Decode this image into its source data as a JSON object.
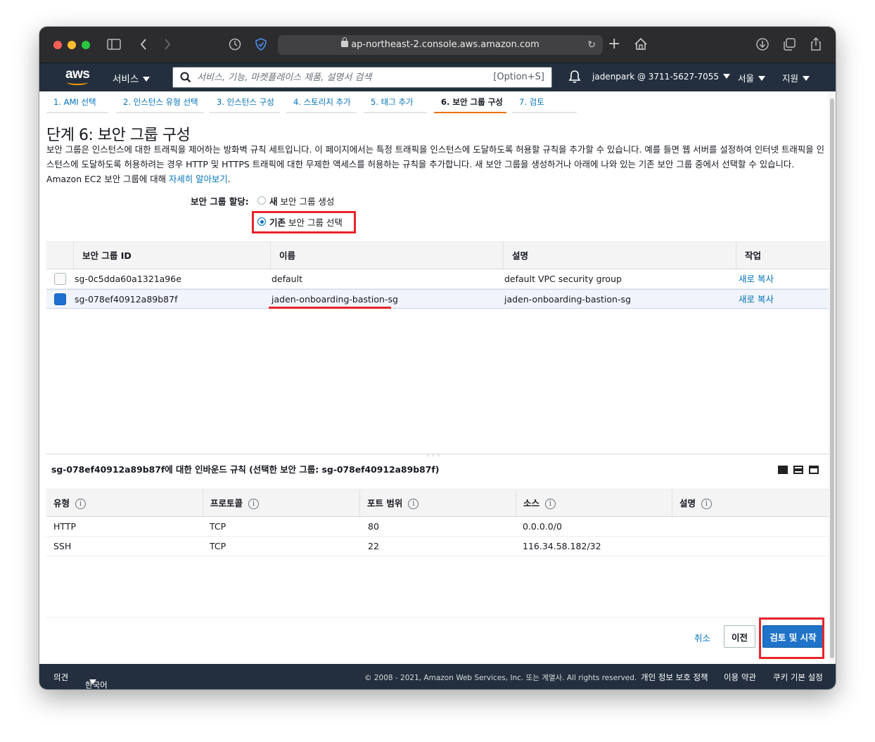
{
  "browser": {
    "url": "ap-northeast-2.console.aws.amazon.com"
  },
  "nav": {
    "logo": "aws",
    "services": "서비스",
    "search_placeholder": "서비스, 기능, 마켓플레이스 제품, 설명서 검색",
    "search_hint": "[Option+S]",
    "user": "jadenpark @ 3711-5627-7055",
    "region": "서울",
    "support": "지원"
  },
  "wizard": {
    "steps": [
      "1. AMI 선택",
      "2. 인스턴스 유형 선택",
      "3. 인스턴스 구성",
      "4. 스토리지 추가",
      "5. 태그 추가",
      "6. 보안 그룹 구성",
      "7. 검토"
    ],
    "active_index": 5
  },
  "page": {
    "title": "단계 6: 보안 그룹 구성",
    "description": "보안 그룹은 인스턴스에 대한 트래픽을 제어하는 방화벽 규칙 세트입니다. 이 페이지에서는 특정 트래픽을 인스턴스에 도달하도록 허용할 규칙을 추가할 수 있습니다. 예를 들면 웹 서버를 설정하여 인터넷 트래픽을 인스턴스에 도달하도록 허용하려는 경우 HTTP 및 HTTPS 트래픽에 대한 무제한 액세스를 허용하는 규칙을 추가합니다. 새 보안 그룹을 생성하거나 아래에 나와 있는 기존 보안 그룹 중에서 선택할 수 있습니다. Amazon EC2 보안 그룹에 대해 ",
    "learn_more": "자세히 알아보기",
    "desc_end": ".",
    "assign_label": "보안 그룹 할당:",
    "option_new_bold": "새",
    "option_new_rest": " 보안 그룹 생성",
    "option_existing_bold": "기존",
    "option_existing_rest": " 보안 그룹 선택",
    "selected_option": "existing"
  },
  "sg_table": {
    "headers": [
      "보안 그룹 ID",
      "이름",
      "설명",
      "작업"
    ],
    "rows": [
      {
        "id": "sg-0c5dda60a1321a96e",
        "name": "default",
        "description": "default VPC security group",
        "action": "새로 복사",
        "selected": false
      },
      {
        "id": "sg-078ef40912a89b87f",
        "name": "jaden-onboarding-bastion-sg",
        "description": "jaden-onboarding-bastion-sg",
        "action": "새로 복사",
        "selected": true
      }
    ]
  },
  "inbound": {
    "title": "sg-078ef40912a89b87f에 대한 인바운드 규칙 (선택한 보안 그룹: sg-078ef40912a89b87f)",
    "headers": [
      "유형",
      "프로토콜",
      "포트 범위",
      "소스",
      "설명"
    ],
    "info_glyph": "i",
    "rows": [
      {
        "type": "HTTP",
        "protocol": "TCP",
        "port": "80",
        "source": "0.0.0.0/0",
        "description": ""
      },
      {
        "type": "SSH",
        "protocol": "TCP",
        "port": "22",
        "source": "116.34.58.182/32",
        "description": ""
      }
    ]
  },
  "actions": {
    "cancel": "취소",
    "previous": "이전",
    "launch": "검토 및 시작"
  },
  "footer": {
    "feedback": "의견",
    "language": "한국어",
    "copyright": "© 2008 - 2021, Amazon Web Services, Inc. 또는 계열사. All rights reserved.",
    "privacy": "개인 정보 보호 정책",
    "terms": "이용 약관",
    "cookies": "쿠키 기본 설정"
  },
  "colors": {
    "aws_nav": "#232f3e",
    "link": "#0073bb",
    "active_tab": "#ec7211",
    "highlight_annotation": "#e8242b",
    "primary_button": "#1f73c9"
  }
}
